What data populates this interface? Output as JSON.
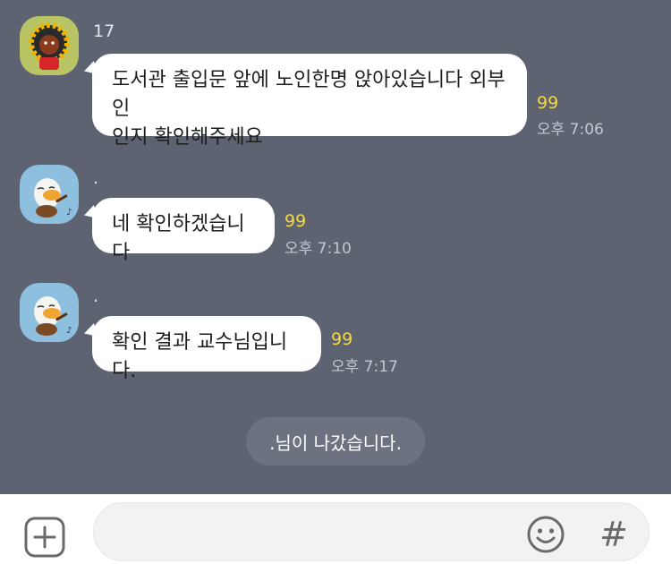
{
  "messages": [
    {
      "sender": "17",
      "avatar": "lion-character-avatar",
      "text": "도서관 출입문 앞에 노인한명 앉아있습니다 외부인\n인지 확인해주세요",
      "unread": "99",
      "time": "오후 7:06"
    },
    {
      "sender": ".",
      "avatar": "duck-guitar-avatar",
      "text": "네 확인하겠습니다",
      "unread": "99",
      "time": "오후 7:10"
    },
    {
      "sender": ".",
      "avatar": "duck-guitar-avatar",
      "text": "확인 결과 교수님입니다.",
      "unread": "99",
      "time": "오후 7:17"
    }
  ],
  "notice": ".님이 나갔습니다.",
  "input_bar": {
    "plus_icon": "plus-square-icon",
    "emoji_icon": "smile-icon",
    "hash_label": "#"
  },
  "colors": {
    "chat_background": "#5e6371",
    "bubble": "#ffffff",
    "unread": "#f5d845",
    "time": "#c3c7cf",
    "notice_pill": "#6d7280"
  }
}
